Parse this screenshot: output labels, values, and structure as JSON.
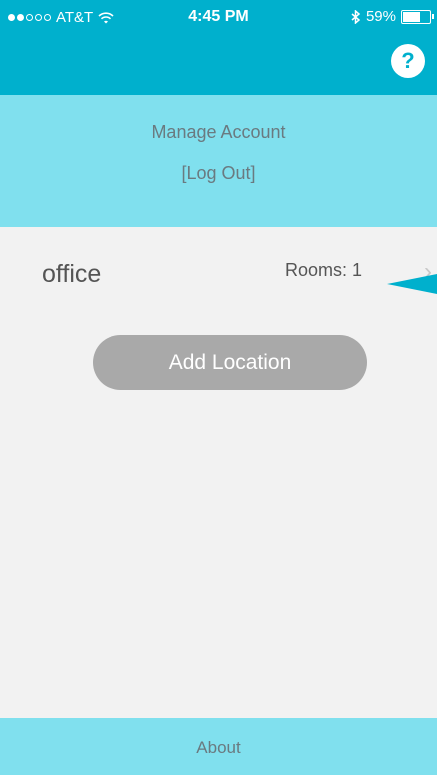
{
  "status_bar": {
    "carrier": "AT&T",
    "time": "4:45 PM",
    "battery_percent": "59%",
    "battery_level": 0.59,
    "signal_bars_filled": 2,
    "signal_bars_total": 5,
    "icons": [
      "wifi-icon",
      "bluetooth-icon",
      "battery-icon"
    ]
  },
  "navbar": {
    "help_label": "?"
  },
  "account": {
    "manage_label": "Manage Account",
    "logout_label": "[Log Out]"
  },
  "locations": [
    {
      "name": "office",
      "rooms_text": "Rooms: 1"
    }
  ],
  "add_location_label": "Add Location",
  "footer": {
    "about_label": "About"
  },
  "colors": {
    "header": "#00b0cd",
    "account_band": "#80e0ee",
    "background": "#f2f2f2",
    "button": "#a9a9a9"
  }
}
